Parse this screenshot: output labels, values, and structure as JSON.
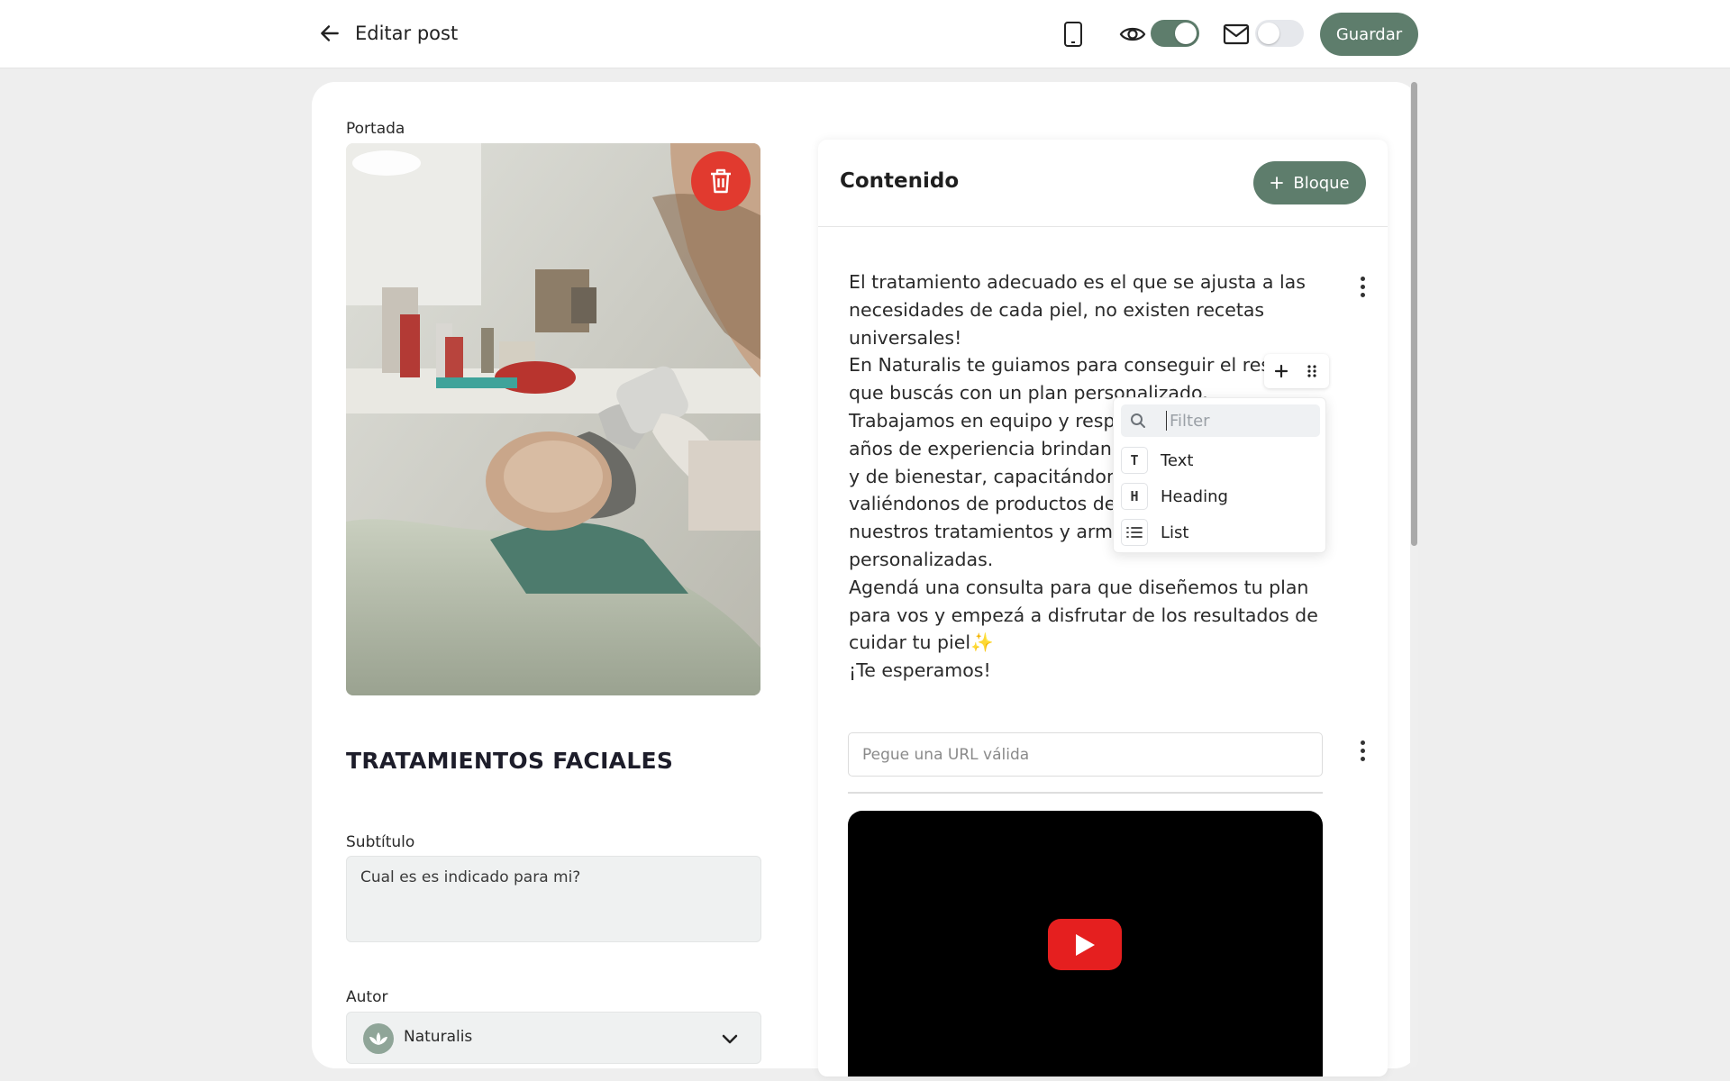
{
  "header": {
    "title": "Editar post",
    "save_label": "Guardar",
    "preview_toggle": true,
    "email_toggle": false
  },
  "cover": {
    "label": "Portada"
  },
  "post": {
    "title": "TRATAMIENTOS FACIALES",
    "subtitle_label": "Subtítulo",
    "subtitle_value": "Cual es es indicado para mi?",
    "author_label": "Autor",
    "author_value": "Naturalis"
  },
  "content": {
    "title": "Contenido",
    "add_block_label": "Bloque",
    "text_lines": [
      "El tratamiento adecuado es el que se ajusta a las",
      "necesidades de cada piel, no existen recetas",
      "universales!",
      "En Naturalis te guiamos para conseguir el result",
      "que buscás con un plan personalizado.",
      "Trabajamos en equipo y respo",
      "años de experiencia brindand",
      "y de bienestar, capacitándono",
      "valiéndonos de productos de c",
      "nuestros tratamientos y armad",
      "personalizadas.",
      "Agendá una consulta para que diseñemos tu plan",
      "para vos y empezá a disfrutar de los resultados de",
      "cuidar tu piel✨",
      "¡Te esperamos!"
    ],
    "url_placeholder": "Pegue una URL válida"
  },
  "block_menu": {
    "filter_placeholder": "Filter",
    "items": [
      {
        "icon": "T",
        "label": "Text"
      },
      {
        "icon": "H",
        "label": "Heading"
      },
      {
        "icon": "list-icon",
        "label": "List"
      }
    ]
  },
  "colors": {
    "accent": "#5e7d6c",
    "danger": "#e13a2f",
    "youtube": "#e51f1f"
  }
}
